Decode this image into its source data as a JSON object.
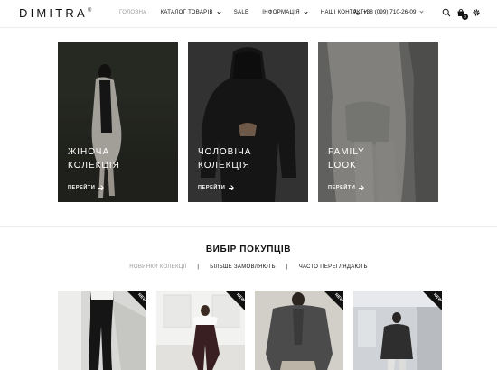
{
  "brand": {
    "name": "DIMITRA",
    "mark": "®"
  },
  "nav": {
    "items": [
      {
        "label": "ГОЛОВНА",
        "active": true,
        "dropdown": false
      },
      {
        "label": "КАТАЛОГ ТОВАРІВ",
        "active": false,
        "dropdown": true
      },
      {
        "label": "SALE",
        "active": false,
        "dropdown": false
      },
      {
        "label": "ІНФОРМАЦІЯ",
        "active": false,
        "dropdown": true
      },
      {
        "label": "НАШІ КОНТАКТИ",
        "active": false,
        "dropdown": false
      }
    ],
    "phone": "+38 (099) 710-26-09",
    "cart_count": "0"
  },
  "banners": [
    {
      "title_line1": "ЖІНОЧА",
      "title_line2": "КОЛЕКЦІЯ",
      "link": "ПЕРЕЙТИ"
    },
    {
      "title_line1": "ЧОЛОВІЧА",
      "title_line2": "КОЛЕКЦІЯ",
      "link": "ПЕРЕЙТИ"
    },
    {
      "title_line1": "FAMILY",
      "title_line2": "LOOK",
      "link": "ПЕРЕЙТИ"
    }
  ],
  "picks": {
    "title": "ВИБІР ПОКУПЦІВ",
    "tabs": [
      "НОВИНКИ КОЛЕКЦІЇ",
      "БІЛЬШЕ ЗАМОВЛЯЮТЬ",
      "ЧАСТО ПЕРЕГЛЯДАЮТЬ"
    ],
    "active_tab": 0,
    "separator": "|"
  },
  "products": [
    {
      "badge": "NEW"
    },
    {
      "badge": "NEW"
    },
    {
      "badge": "NEW"
    },
    {
      "badge": "NEW"
    }
  ],
  "colors": {
    "text": "#111111",
    "muted": "#9a9a9a",
    "badge": "#111111"
  }
}
